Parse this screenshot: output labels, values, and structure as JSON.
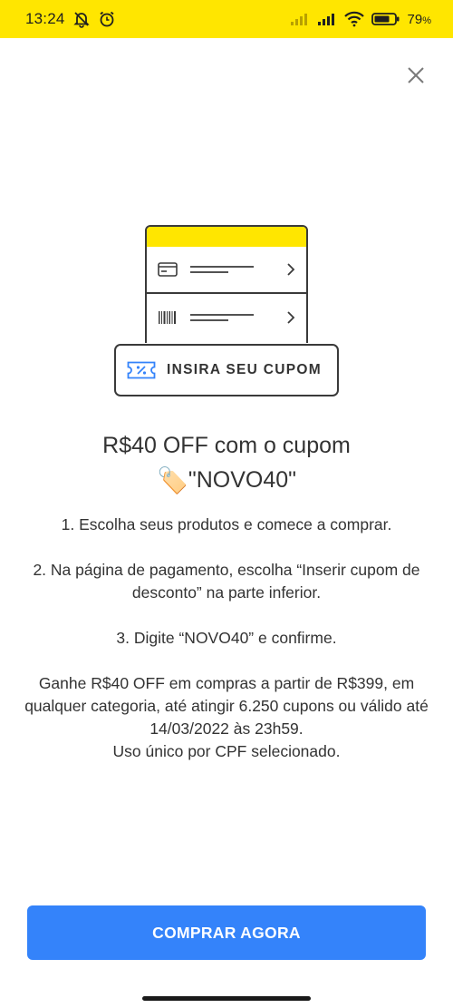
{
  "status_bar": {
    "time": "13:24",
    "battery_percent": "79",
    "battery_suffix": "%",
    "icons": [
      "mute-icon",
      "alarm-icon",
      "signal-icon",
      "signal-icon",
      "wifi-icon",
      "battery-icon"
    ]
  },
  "illustration": {
    "coupon_label": "INSIRA SEU CUPOM",
    "icons": [
      "credit-card-icon",
      "barcode-icon",
      "chevron-right-icon",
      "coupon-percent-icon"
    ]
  },
  "title": {
    "line1": "R$40 OFF com o cupom",
    "emoji": "🏷️",
    "code": "\"NOVO40\""
  },
  "body": {
    "step1": "1. Escolha seus produtos e comece a comprar.",
    "step2": "2. Na página de pagamento, escolha “Inserir cupom de desconto” na parte inferior.",
    "step3": "3. Digite “NOVO40” e confirme.",
    "terms": "Ganhe R$40 OFF em compras a partir de R$399, em qualquer categoria, até atingir 6.250 cupons ou válido até 14/03/2022 às 23h59.",
    "usage": "Uso único por CPF selecionado."
  },
  "cta": {
    "label": "COMPRAR AGORA"
  },
  "colors": {
    "brand_yellow": "#ffe600",
    "primary_blue": "#3483fa",
    "text": "#333333",
    "coupon_icon_blue": "#3483fa"
  }
}
